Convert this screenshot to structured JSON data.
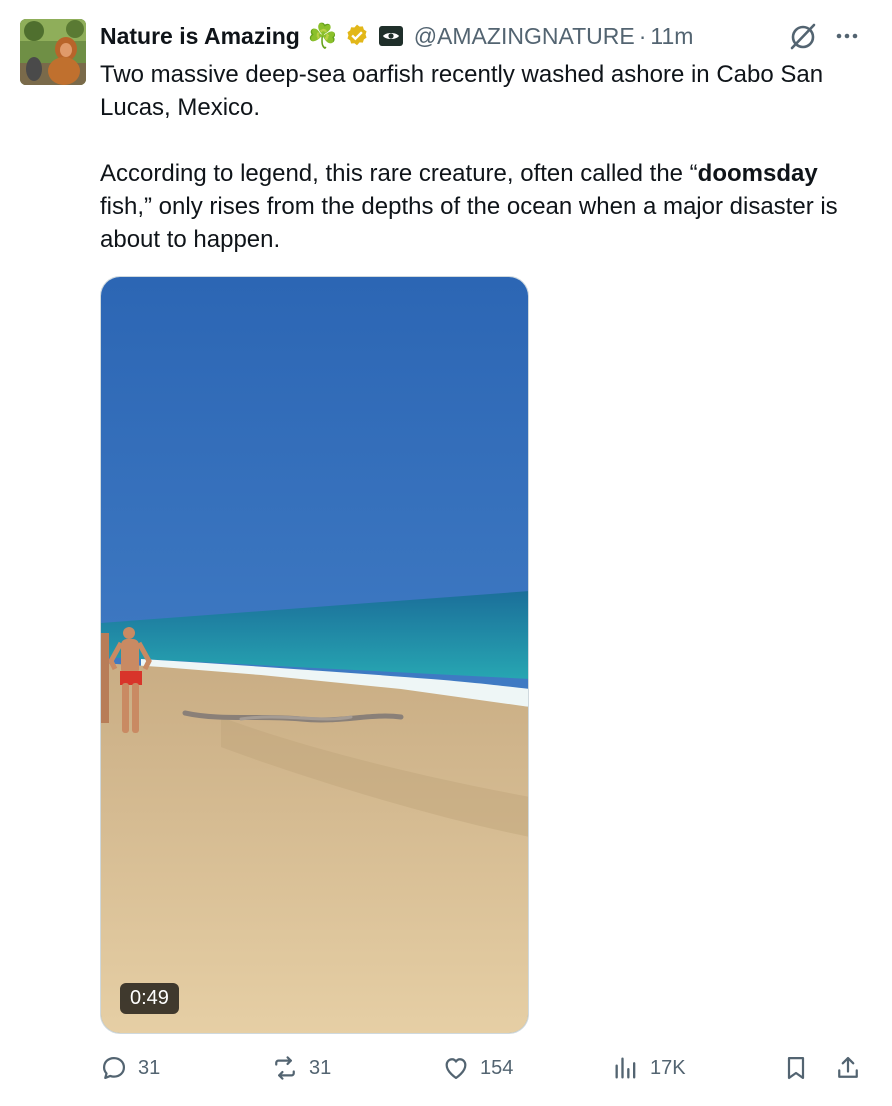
{
  "author": {
    "name": "Nature is Amazing",
    "emoji": "☘️",
    "handle": "@AMAZINGNATURE",
    "separator": "·",
    "time": "11m"
  },
  "tweet": {
    "line1": "Two massive deep-sea oarfish recently washed ashore in Cabo San Lucas, Mexico.",
    "p2_pre": "According to legend, this rare creature, often called the “",
    "p2_bold": "doomsday",
    "p2_post": " fish,” only rises from the depths of the ocean when a major disaster is about to happen."
  },
  "media": {
    "duration": "0:49"
  },
  "actions": {
    "replies": "31",
    "reposts": "31",
    "likes": "154",
    "views": "17K"
  },
  "icons": {
    "reply": "reply-icon",
    "repost": "repost-icon",
    "like": "heart-icon",
    "views": "views-icon",
    "bookmark": "bookmark-icon",
    "share": "share-icon",
    "grok": "grok-icon",
    "more": "more-icon"
  },
  "colors": {
    "text": "#0f1419",
    "secondary": "#536471",
    "verified_gold": "#e2b719",
    "clover_green": "#4c9a2a"
  }
}
